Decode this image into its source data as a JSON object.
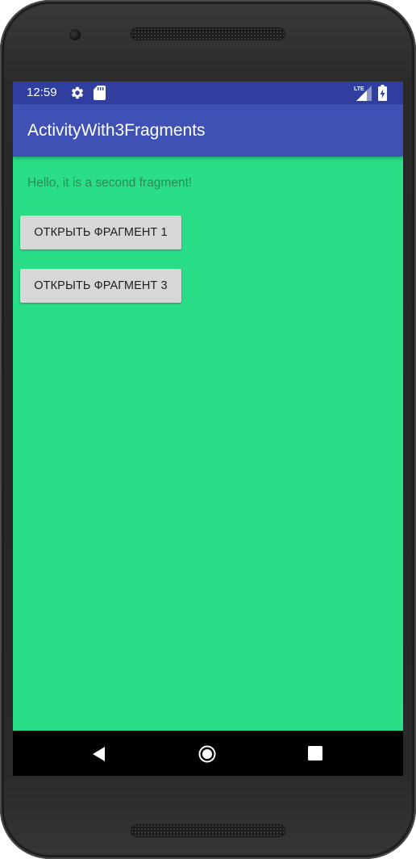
{
  "status_bar": {
    "time": "12:59",
    "icons": [
      "settings-gear-icon",
      "sd-card-icon",
      "lte-signal-icon",
      "battery-charging-icon"
    ],
    "network_label": "LTE"
  },
  "app_bar": {
    "title": "ActivityWith3Fragments",
    "color": "#3f51b5",
    "status_color": "#303f9f"
  },
  "fragment": {
    "text": "Hello, it is a second fragment!",
    "background_color": "#2add87",
    "text_color": "#2e8b57"
  },
  "buttons": [
    {
      "label": "ОТКРЫТЬ ФРАГМЕНТ 1"
    },
    {
      "label": "ОТКРЫТЬ ФРАГМЕНТ 3"
    }
  ],
  "nav_bar": {
    "icons": [
      "back-triangle-icon",
      "home-circle-icon",
      "recents-square-icon"
    ]
  }
}
